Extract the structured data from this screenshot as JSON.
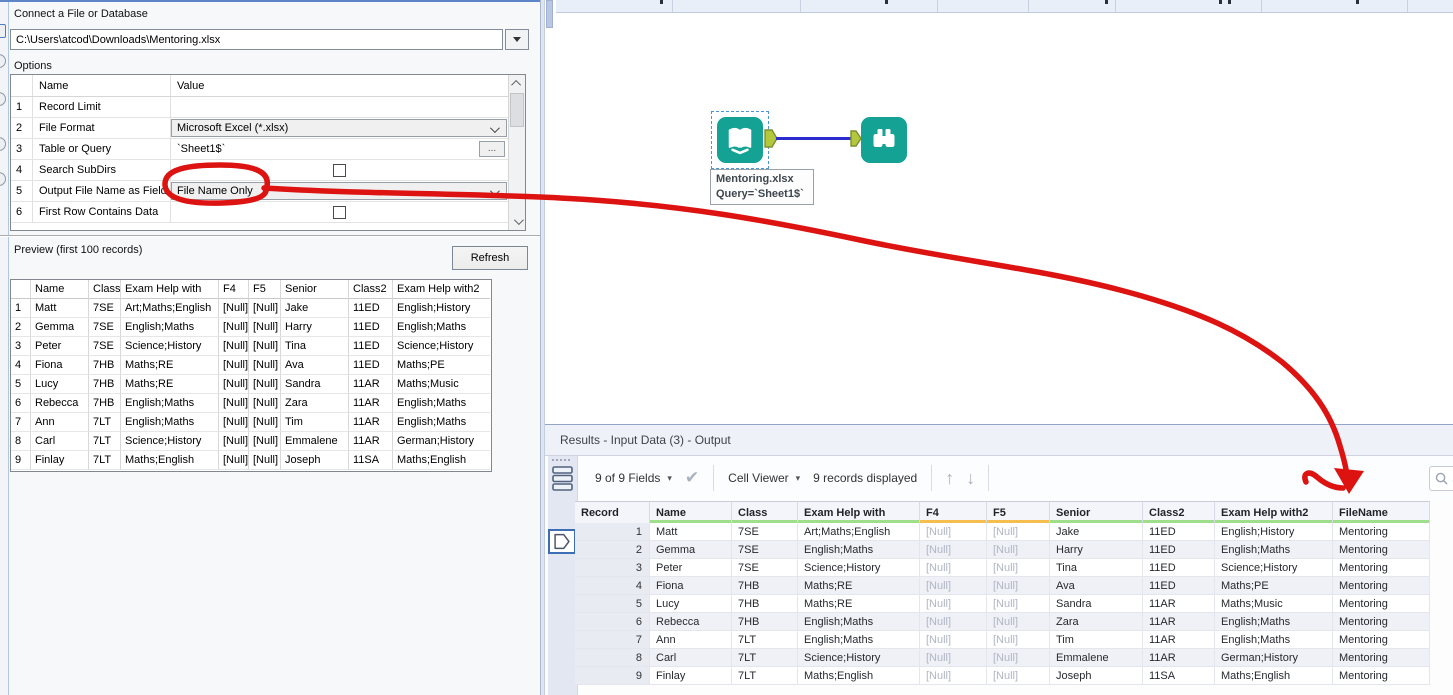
{
  "config": {
    "connect_label": "Connect a File or Database",
    "file_path": "C:\\Users\\atcod\\Downloads\\Mentoring.xlsx",
    "options_label": "Options",
    "options_headers": {
      "name": "Name",
      "value": "Value"
    },
    "options_rows": [
      {
        "num": "1",
        "name": "Record Limit",
        "type": "empty",
        "value": ""
      },
      {
        "num": "2",
        "name": "File Format",
        "type": "dropdown",
        "value": "Microsoft Excel (*.xlsx)"
      },
      {
        "num": "3",
        "name": "Table or Query",
        "type": "text",
        "value": "`Sheet1$`",
        "button": "..."
      },
      {
        "num": "4",
        "name": "Search SubDirs",
        "type": "checkbox",
        "checked": false
      },
      {
        "num": "5",
        "name": "Output File Name as Field",
        "type": "dropdown",
        "value": "File Name Only"
      },
      {
        "num": "6",
        "name": "First Row Contains Data",
        "type": "checkbox",
        "checked": false
      }
    ],
    "preview_label": "Preview (first 100 records)",
    "refresh_label": "Refresh",
    "preview_columns": [
      "",
      "Name",
      "Class",
      "Exam Help with",
      "F4",
      "F5",
      "Senior",
      "Class2",
      "Exam Help with2"
    ],
    "preview_rows": [
      [
        "1",
        "Matt",
        "7SE",
        "Art;Maths;English",
        "[Null]",
        "[Null]",
        "Jake",
        "11ED",
        "English;History"
      ],
      [
        "2",
        "Gemma",
        "7SE",
        "English;Maths",
        "[Null]",
        "[Null]",
        "Harry",
        "11ED",
        "English;Maths"
      ],
      [
        "3",
        "Peter",
        "7SE",
        "Science;History",
        "[Null]",
        "[Null]",
        "Tina",
        "11ED",
        "Science;History"
      ],
      [
        "4",
        "Fiona",
        "7HB",
        "Maths;RE",
        "[Null]",
        "[Null]",
        "Ava",
        "11ED",
        "Maths;PE"
      ],
      [
        "5",
        "Lucy",
        "7HB",
        "Maths;RE",
        "[Null]",
        "[Null]",
        "Sandra",
        "11AR",
        "Maths;Music"
      ],
      [
        "6",
        "Rebecca",
        "7HB",
        "English;Maths",
        "[Null]",
        "[Null]",
        "Zara",
        "11AR",
        "English;Maths"
      ],
      [
        "7",
        "Ann",
        "7LT",
        "English;Maths",
        "[Null]",
        "[Null]",
        "Tim",
        "11AR",
        "English;Maths"
      ],
      [
        "8",
        "Carl",
        "7LT",
        "Science;History",
        "[Null]",
        "[Null]",
        "Emmalene",
        "11AR",
        "German;History"
      ],
      [
        "9",
        "Finlay",
        "7LT",
        "Maths;English",
        "[Null]",
        "[Null]",
        "Joseph",
        "11SA",
        "Maths;English"
      ]
    ]
  },
  "canvas": {
    "input_tool_label1": "Mentoring.xlsx",
    "input_tool_label2": "Query=`Sheet1$`"
  },
  "results": {
    "title": "Results - Input Data (3) - Output",
    "toolbar": {
      "fields": "9 of 9 Fields",
      "caret": "▾",
      "check_icon": "✔",
      "cell_viewer": "Cell Viewer",
      "records": "9 records displayed",
      "up_arrow": "↑",
      "down_arrow": "↓",
      "search_placeholder": "Search"
    },
    "columns": [
      {
        "label": "Record",
        "strip": "none"
      },
      {
        "label": "Name",
        "strip": "green"
      },
      {
        "label": "Class",
        "strip": "green"
      },
      {
        "label": "Exam Help with",
        "strip": "green"
      },
      {
        "label": "F4",
        "strip": "orange"
      },
      {
        "label": "F5",
        "strip": "orange"
      },
      {
        "label": "Senior",
        "strip": "green"
      },
      {
        "label": "Class2",
        "strip": "green"
      },
      {
        "label": "Exam Help with2",
        "strip": "green"
      },
      {
        "label": "FileName",
        "strip": "green"
      }
    ],
    "rows": [
      [
        "1",
        "Matt",
        "7SE",
        "Art;Maths;English",
        "[Null]",
        "[Null]",
        "Jake",
        "11ED",
        "English;History",
        "Mentoring"
      ],
      [
        "2",
        "Gemma",
        "7SE",
        "English;Maths",
        "[Null]",
        "[Null]",
        "Harry",
        "11ED",
        "English;Maths",
        "Mentoring"
      ],
      [
        "3",
        "Peter",
        "7SE",
        "Science;History",
        "[Null]",
        "[Null]",
        "Tina",
        "11ED",
        "Science;History",
        "Mentoring"
      ],
      [
        "4",
        "Fiona",
        "7HB",
        "Maths;RE",
        "[Null]",
        "[Null]",
        "Ava",
        "11ED",
        "Maths;PE",
        "Mentoring"
      ],
      [
        "5",
        "Lucy",
        "7HB",
        "Maths;RE",
        "[Null]",
        "[Null]",
        "Sandra",
        "11AR",
        "Maths;Music",
        "Mentoring"
      ],
      [
        "6",
        "Rebecca",
        "7HB",
        "English;Maths",
        "[Null]",
        "[Null]",
        "Zara",
        "11AR",
        "English;Maths",
        "Mentoring"
      ],
      [
        "7",
        "Ann",
        "7LT",
        "English;Maths",
        "[Null]",
        "[Null]",
        "Tim",
        "11AR",
        "English;Maths",
        "Mentoring"
      ],
      [
        "8",
        "Carl",
        "7LT",
        "Science;History",
        "[Null]",
        "[Null]",
        "Emmalene",
        "11AR",
        "German;History",
        "Mentoring"
      ],
      [
        "9",
        "Finlay",
        "7LT",
        "Maths;English",
        "[Null]",
        "[Null]",
        "Joseph",
        "11SA",
        "Maths;English",
        "Mentoring"
      ]
    ]
  },
  "colors": {
    "tool_teal": "#14A294",
    "anchor_olive": "#B3C83C",
    "anchor_border": "#7E8F2E",
    "connection_blue": "#2B2BD0",
    "annotation_red": "#DC1310",
    "strip_green": "#9FDF8C",
    "strip_orange": "#F6BE4F"
  }
}
